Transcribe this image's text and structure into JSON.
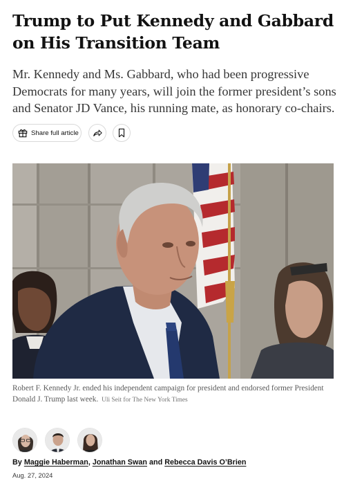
{
  "article": {
    "headline": "Trump to Put Kennedy and Gabbard on His Transition Team",
    "summary": "Mr. Kennedy and Ms. Gabbard, who had been progressive Democrats for many years, will join the former president’s sons and Senator JD Vance, his running mate, as honorary co-chairs.",
    "date": "Aug. 27, 2024"
  },
  "toolbar": {
    "share_label": "Share full article",
    "share_icon": "gift-icon",
    "forward_icon": "share-arrow-icon",
    "bookmark_icon": "bookmark-icon"
  },
  "photo": {
    "caption": "Robert F. Kennedy Jr. ended his independent campaign for president and endorsed former President Donald J. Trump last week.",
    "credit": "Uli Seit for The New York Times"
  },
  "byline": {
    "prefix": "By",
    "authors": [
      "Maggie Haberman",
      "Jonathan Swan",
      "Rebecca Davis O’Brien"
    ],
    "separator": ",",
    "conjunction": "and"
  },
  "colors": {
    "text": "#121212",
    "summary_text": "#363636",
    "caption_text": "#5a5a5a",
    "border": "#d9d9d9"
  }
}
